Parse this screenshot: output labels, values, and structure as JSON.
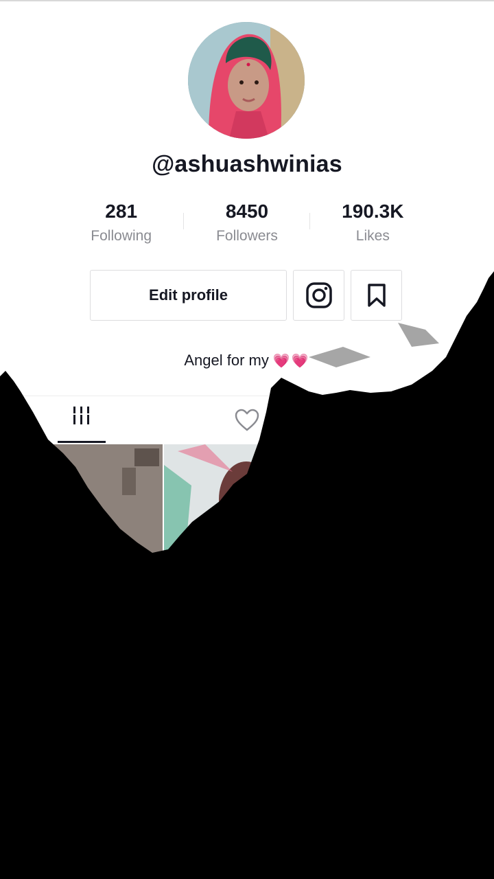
{
  "profile": {
    "username": "@ashuashwinias",
    "bio_text": "Angel for my",
    "bio_emoji": "💗💗"
  },
  "stats": [
    {
      "value": "281",
      "label": "Following"
    },
    {
      "value": "8450",
      "label": "Followers"
    },
    {
      "value": "190.3K",
      "label": "Likes"
    }
  ],
  "actions": {
    "edit_profile_label": "Edit profile",
    "instagram_icon": "instagram-icon",
    "bookmark_icon": "bookmark-icon"
  },
  "tabs": [
    {
      "icon": "grid-icon",
      "active": true
    },
    {
      "icon": "heart-icon",
      "active": false
    }
  ],
  "colors": {
    "text": "#161823",
    "secondary_text": "#8a8b91",
    "heart_emoji": "#d6137f",
    "overlay": "#000000"
  }
}
